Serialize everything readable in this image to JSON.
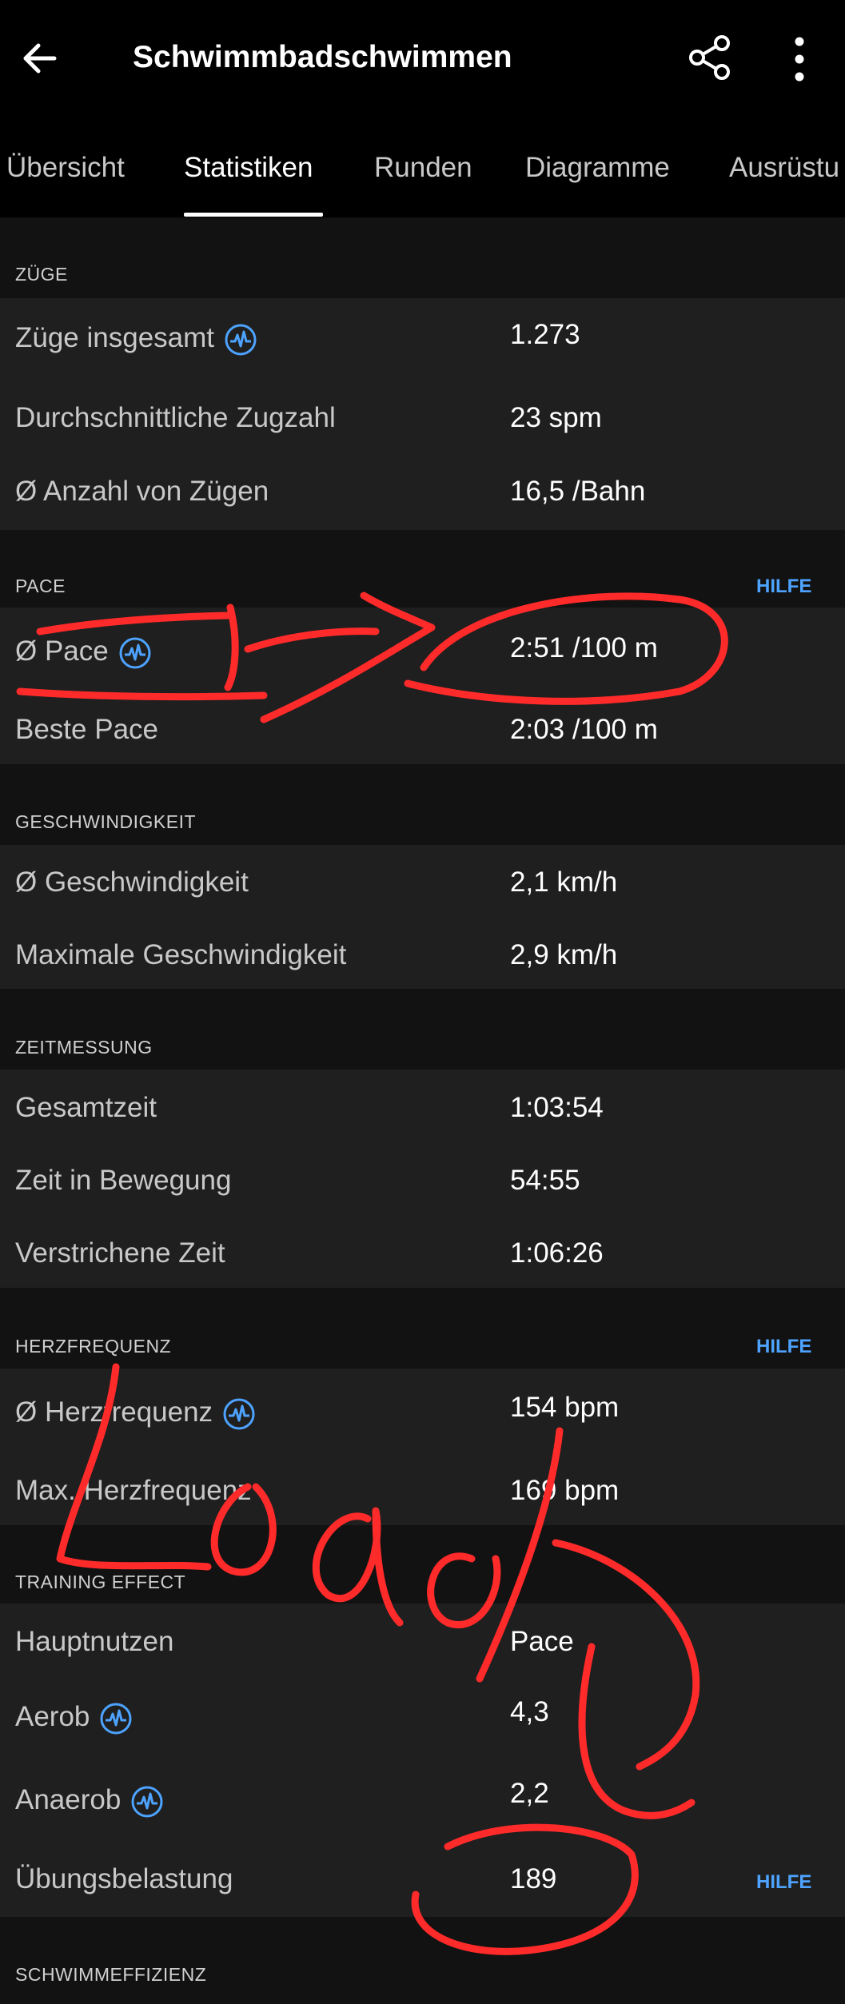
{
  "app_bar": {
    "title": "Schwimmbadschwimmen",
    "back_icon": "arrow-left-icon",
    "share_icon": "share-icon",
    "more_icon": "more-vertical-icon"
  },
  "tabs": [
    {
      "label": "Übersicht"
    },
    {
      "label": "Statistiken",
      "active": true
    },
    {
      "label": "Runden"
    },
    {
      "label": "Diagramme"
    },
    {
      "label": "Ausrüstu"
    }
  ],
  "sections": {
    "zuege": {
      "title": "ZÜGE",
      "rows": [
        {
          "label": "Züge insgesamt",
          "value": "1.273",
          "icon": "activity-info-icon"
        },
        {
          "label": "Durchschnittliche Zugzahl",
          "value": "23 spm"
        },
        {
          "label": "Ø Anzahl von Zügen",
          "value": "16,5 /Bahn"
        }
      ]
    },
    "pace": {
      "title": "PACE",
      "help": "HILFE",
      "rows": [
        {
          "label": "Ø Pace",
          "value": "2:51 /100 m",
          "icon": "activity-info-icon"
        },
        {
          "label": "Beste Pace",
          "value": "2:03 /100 m"
        }
      ]
    },
    "geschwindigkeit": {
      "title": "GESCHWINDIGKEIT",
      "rows": [
        {
          "label": "Ø Geschwindigkeit",
          "value": "2,1 km/h"
        },
        {
          "label": "Maximale Geschwindigkeit",
          "value": "2,9 km/h"
        }
      ]
    },
    "zeitmessung": {
      "title": "ZEITMESSUNG",
      "rows": [
        {
          "label": "Gesamtzeit",
          "value": "1:03:54"
        },
        {
          "label": "Zeit in Bewegung",
          "value": "54:55"
        },
        {
          "label": "Verstrichene Zeit",
          "value": "1:06:26"
        }
      ]
    },
    "herzfrequenz": {
      "title": "HERZFREQUENZ",
      "help": "HILFE",
      "rows": [
        {
          "label": "Ø Herzfrequenz",
          "value": "154 bpm",
          "icon": "activity-info-icon"
        },
        {
          "label": "Max. Herzfrequenz",
          "value": "169 bpm"
        }
      ]
    },
    "training_effect": {
      "title": "TRAINING EFFECT",
      "rows": [
        {
          "label": "Hauptnutzen",
          "value": "Pace"
        },
        {
          "label": "Aerob",
          "value": "4,3",
          "icon": "activity-info-icon"
        },
        {
          "label": "Anaerob",
          "value": "2,2",
          "icon": "activity-info-icon"
        },
        {
          "label": "Übungsbelastung",
          "value": "189",
          "help": "HILFE"
        }
      ]
    },
    "schwimmeffizienz": {
      "title": "SCHWIMMEFFIZIENZ"
    }
  },
  "colors": {
    "background": "#121212",
    "row_background": "#1f1f1f",
    "accent": "#4da3ff",
    "annotation": "#ff2a2a"
  },
  "annotations": {
    "handwritten_text": "Load?"
  }
}
